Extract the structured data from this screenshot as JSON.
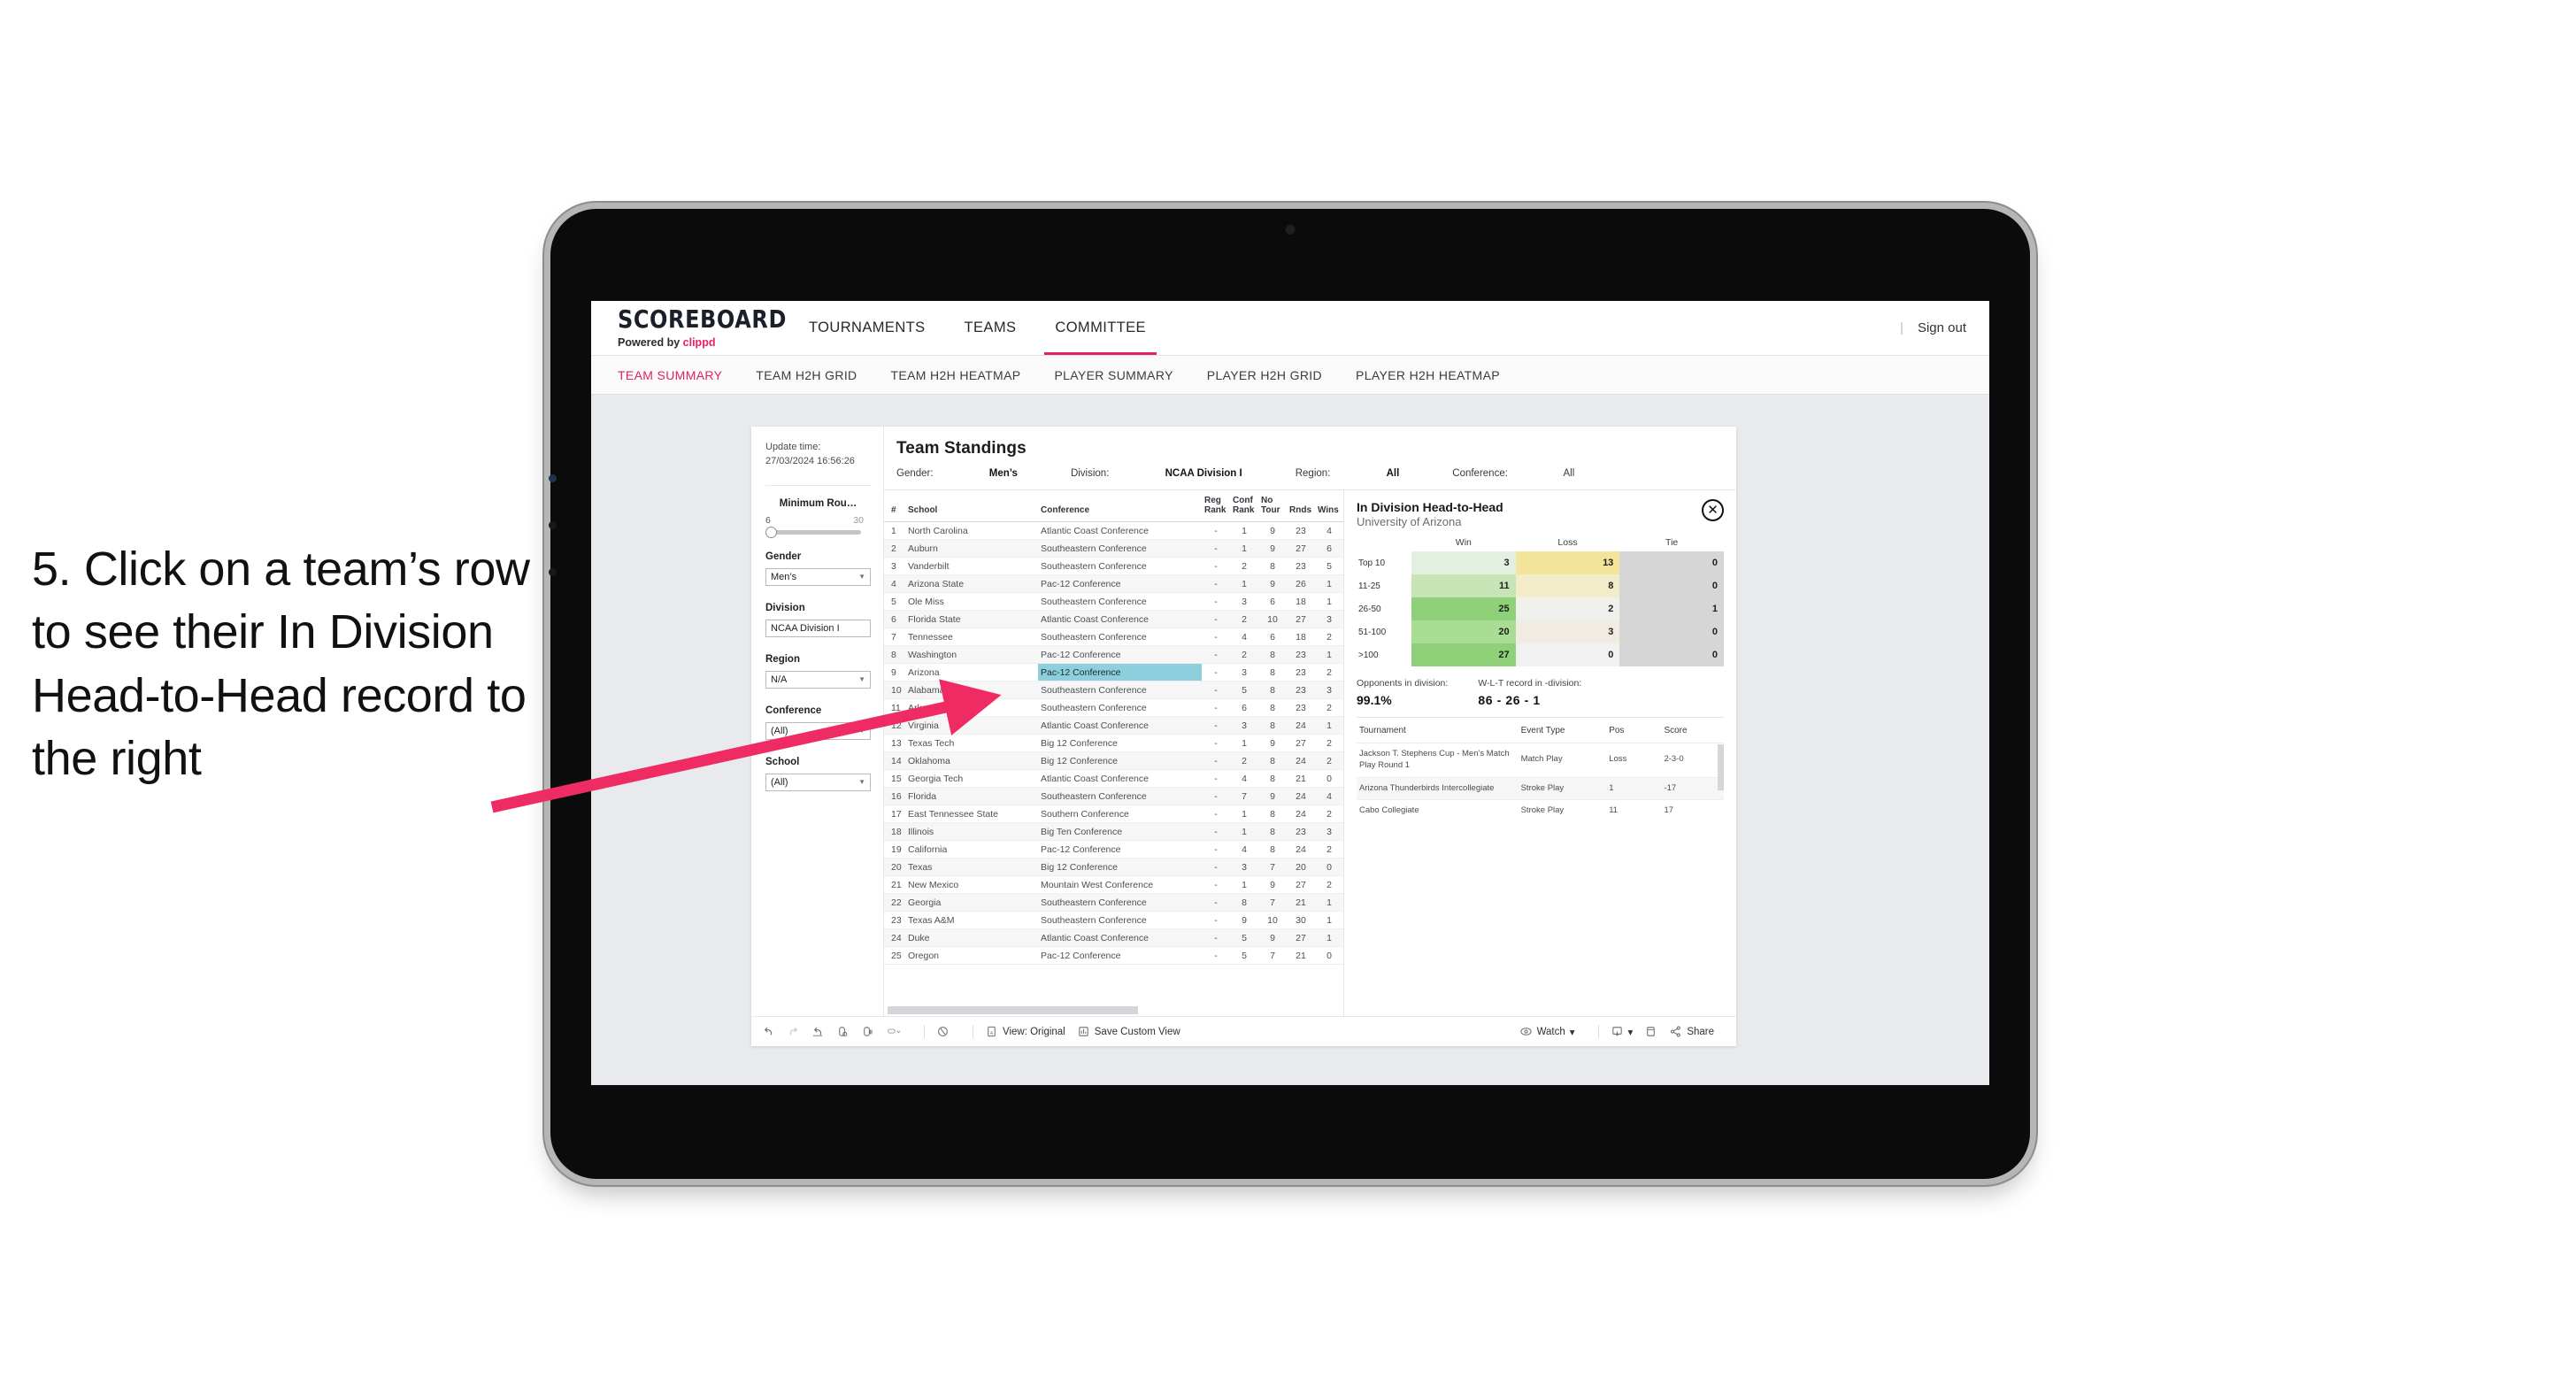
{
  "annotation": {
    "text": "5. Click on a team’s row to see their In Division Head-to-Head record to the right",
    "arrow_color": "#ef2b63"
  },
  "app": {
    "logo": {
      "name": "SCOREBOARD",
      "powered_prefix": "Powered by",
      "powered_brand": "clippd"
    },
    "nav": [
      {
        "label": "TOURNAMENTS",
        "selected": false
      },
      {
        "label": "TEAMS",
        "selected": false
      },
      {
        "label": "COMMITTEE",
        "selected": true
      }
    ],
    "sign_out": "Sign out",
    "divider": "|",
    "subtabs": [
      {
        "label": "TEAM SUMMARY",
        "selected": true
      },
      {
        "label": "TEAM H2H GRID",
        "selected": false
      },
      {
        "label": "TEAM H2H HEATMAP",
        "selected": false
      },
      {
        "label": "PLAYER SUMMARY",
        "selected": false
      },
      {
        "label": "PLAYER H2H GRID",
        "selected": false
      },
      {
        "label": "PLAYER H2H HEATMAP",
        "selected": false
      }
    ]
  },
  "filters": {
    "update_label": "Update time:",
    "update_value": "27/03/2024 16:56:26",
    "slider": {
      "label": "Minimum Rou…",
      "min": "6",
      "max": "30"
    },
    "groups": [
      {
        "label": "Gender",
        "value": "Men’s"
      },
      {
        "label": "Division",
        "value": "NCAA Division I"
      },
      {
        "label": "Region",
        "value": "N/A"
      },
      {
        "label": "Conference",
        "value": "(All)"
      },
      {
        "label": "School",
        "value": "(All)"
      }
    ]
  },
  "standings": {
    "title": "Team Standings",
    "meta": [
      {
        "key": "Gender:",
        "value": "Men’s"
      },
      {
        "key": "Division:",
        "value": "NCAA Division I"
      },
      {
        "key": "Region:",
        "value": "All"
      },
      {
        "key": "Conference:",
        "value": "All"
      }
    ],
    "columns": [
      "#",
      "School",
      "Conference",
      "Reg Rank",
      "Conf Rank",
      "No Tour",
      "Rnds",
      "Wins"
    ],
    "highlight_row_index": 8,
    "rows": [
      [
        "1",
        "North Carolina",
        "Atlantic Coast Conference",
        "-",
        "1",
        "9",
        "23",
        "4"
      ],
      [
        "2",
        "Auburn",
        "Southeastern Conference",
        "-",
        "1",
        "9",
        "27",
        "6"
      ],
      [
        "3",
        "Vanderbilt",
        "Southeastern Conference",
        "-",
        "2",
        "8",
        "23",
        "5"
      ],
      [
        "4",
        "Arizona State",
        "Pac-12 Conference",
        "-",
        "1",
        "9",
        "26",
        "1"
      ],
      [
        "5",
        "Ole Miss",
        "Southeastern Conference",
        "-",
        "3",
        "6",
        "18",
        "1"
      ],
      [
        "6",
        "Florida State",
        "Atlantic Coast Conference",
        "-",
        "2",
        "10",
        "27",
        "3"
      ],
      [
        "7",
        "Tennessee",
        "Southeastern Conference",
        "-",
        "4",
        "6",
        "18",
        "2"
      ],
      [
        "8",
        "Washington",
        "Pac-12 Conference",
        "-",
        "2",
        "8",
        "23",
        "1"
      ],
      [
        "9",
        "Arizona",
        "Pac-12 Conference",
        "-",
        "3",
        "8",
        "23",
        "2"
      ],
      [
        "10",
        "Alabama",
        "Southeastern Conference",
        "-",
        "5",
        "8",
        "23",
        "3"
      ],
      [
        "11",
        "Arkansas",
        "Southeastern Conference",
        "-",
        "6",
        "8",
        "23",
        "2"
      ],
      [
        "12",
        "Virginia",
        "Atlantic Coast Conference",
        "-",
        "3",
        "8",
        "24",
        "1"
      ],
      [
        "13",
        "Texas Tech",
        "Big 12 Conference",
        "-",
        "1",
        "9",
        "27",
        "2"
      ],
      [
        "14",
        "Oklahoma",
        "Big 12 Conference",
        "-",
        "2",
        "8",
        "24",
        "2"
      ],
      [
        "15",
        "Georgia Tech",
        "Atlantic Coast Conference",
        "-",
        "4",
        "8",
        "21",
        "0"
      ],
      [
        "16",
        "Florida",
        "Southeastern Conference",
        "-",
        "7",
        "9",
        "24",
        "4"
      ],
      [
        "17",
        "East Tennessee State",
        "Southern Conference",
        "-",
        "1",
        "8",
        "24",
        "2"
      ],
      [
        "18",
        "Illinois",
        "Big Ten Conference",
        "-",
        "1",
        "8",
        "23",
        "3"
      ],
      [
        "19",
        "California",
        "Pac-12 Conference",
        "-",
        "4",
        "8",
        "24",
        "2"
      ],
      [
        "20",
        "Texas",
        "Big 12 Conference",
        "-",
        "3",
        "7",
        "20",
        "0"
      ],
      [
        "21",
        "New Mexico",
        "Mountain West Conference",
        "-",
        "1",
        "9",
        "27",
        "2"
      ],
      [
        "22",
        "Georgia",
        "Southeastern Conference",
        "-",
        "8",
        "7",
        "21",
        "1"
      ],
      [
        "23",
        "Texas A&M",
        "Southeastern Conference",
        "-",
        "9",
        "10",
        "30",
        "1"
      ],
      [
        "24",
        "Duke",
        "Atlantic Coast Conference",
        "-",
        "5",
        "9",
        "27",
        "1"
      ],
      [
        "25",
        "Oregon",
        "Pac-12 Conference",
        "-",
        "5",
        "7",
        "21",
        "0"
      ]
    ]
  },
  "h2h": {
    "title": "In Division Head-to-Head",
    "subtitle": "University of Arizona",
    "close_icon": "✕",
    "heatmap": {
      "columns": [
        "Win",
        "Loss",
        "Tie"
      ],
      "rows": [
        {
          "label": "Top 10",
          "win": "3",
          "loss": "13",
          "tie": "0",
          "win_color": "#e3efe0",
          "loss_color": "#f2e49a",
          "tie_color": "#d6d6d6"
        },
        {
          "label": "11-25",
          "win": "11",
          "loss": "8",
          "tie": "0",
          "win_color": "#c6e4b5",
          "loss_color": "#f3ecca",
          "tie_color": "#d6d6d6"
        },
        {
          "label": "26-50",
          "win": "25",
          "loss": "2",
          "tie": "1",
          "win_color": "#8ed178",
          "loss_color": "#f0f0ec",
          "tie_color": "#d6d6d6"
        },
        {
          "label": "51-100",
          "win": "20",
          "loss": "3",
          "tie": "0",
          "win_color": "#a9dd94",
          "loss_color": "#f1ece1",
          "tie_color": "#d6d6d6"
        },
        {
          "label": ">100",
          "win": "27",
          "loss": "0",
          "tie": "0",
          "win_color": "#8ed178",
          "loss_color": "#f1f1f1",
          "tie_color": "#d6d6d6"
        }
      ]
    },
    "stats": [
      {
        "key": "Opponents in division:",
        "value": "99.1%"
      },
      {
        "key": "W-L-T record in -division:",
        "value": "86 - 26 - 1"
      }
    ],
    "tournaments": {
      "columns": [
        "Tournament",
        "Event Type",
        "Pos",
        "Score"
      ],
      "rows": [
        [
          "Jackson T. Stephens Cup - Men’s Match Play Round 1",
          "Match Play",
          "Loss",
          "2-3-0"
        ],
        [
          "Arizona Thunderbirds Intercollegiate",
          "Stroke Play",
          "1",
          "-17"
        ],
        [
          "Cabo Collegiate",
          "Stroke Play",
          "11",
          "17"
        ]
      ]
    }
  },
  "toolbar": {
    "view_label": "View: Original",
    "save_label": "Save Custom View",
    "watch_label": "Watch",
    "share_label": "Share",
    "caret": "▾"
  }
}
